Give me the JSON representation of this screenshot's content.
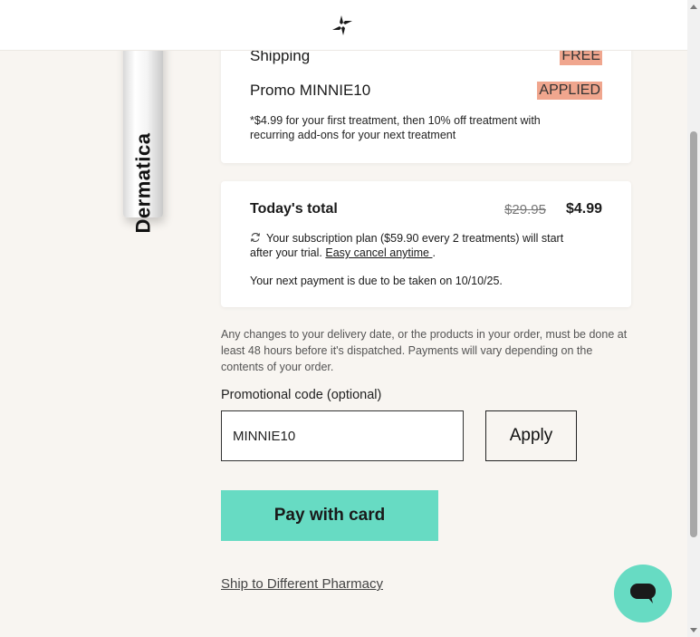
{
  "header": {
    "logo_icon": "dermatica-star-logo"
  },
  "product": {
    "brand_text": "Dermatica"
  },
  "summary": {
    "shipping_label": "Shipping",
    "shipping_value": "FREE",
    "promo_label": "Promo MINNIE10",
    "promo_value": "APPLIED",
    "note": "*$4.99 for your first treatment, then 10% off treatment with recurring add-ons for your next treatment",
    "badge_color": "#f0a68e"
  },
  "total": {
    "label": "Today's total",
    "old_price": "$29.95",
    "new_price": "$4.99",
    "subscription_text": "Your subscription plan ($59.90 every 2 treatments) will start after your trial.",
    "cancel_link": "Easy cancel anytime ",
    "period": ".",
    "next_payment": "Your next payment is due to be taken on 10/10/25."
  },
  "disclaimer": "Any changes to your delivery date, or the products in your order, must be done at least 48 hours before it's dispatched. Payments will vary depending on the contents of your order.",
  "promo": {
    "label": "Promotional code (optional)",
    "value": "MINNIE10",
    "apply_label": "Apply"
  },
  "pay": {
    "label": "Pay with card",
    "color": "#67dbc3"
  },
  "ship_link": "Ship to Different Pharmacy",
  "chat": {
    "icon": "chat-bubble-icon"
  }
}
